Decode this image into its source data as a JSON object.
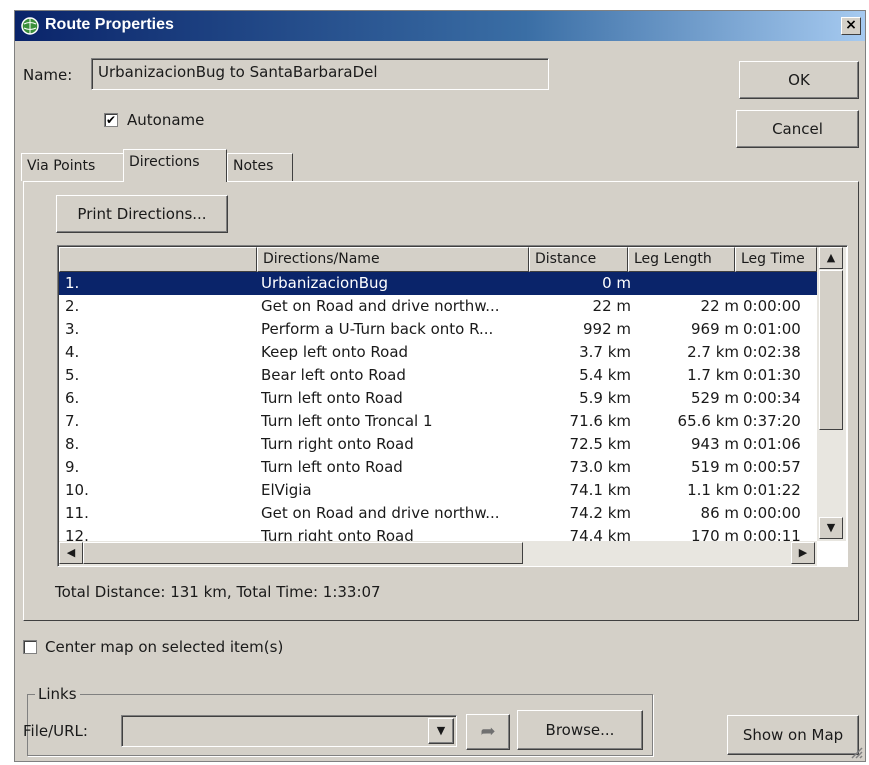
{
  "window": {
    "title": "Route Properties",
    "close_glyph": "×",
    "icon": "globe-icon"
  },
  "name_field": {
    "label": "Name:",
    "value": "UrbanizacionBug to SantaBarbaraDel"
  },
  "autoname": {
    "label": "Autoname",
    "checked": true
  },
  "buttons": {
    "ok": "OK",
    "cancel": "Cancel",
    "print": "Print Directions...",
    "browse": "Browse...",
    "show_on_map": "Show on Map"
  },
  "tabs": [
    {
      "label": "Via Points",
      "active": false
    },
    {
      "label": "Directions",
      "active": true
    },
    {
      "label": "Notes",
      "active": false
    }
  ],
  "table": {
    "columns": [
      "",
      "Directions/Name",
      "Distance",
      "Leg Length",
      "Leg Time"
    ],
    "rows": [
      {
        "num": "1.",
        "name": "UrbanizacionBug",
        "distance": "0 m",
        "leg_length": "",
        "leg_time": "",
        "selected": true
      },
      {
        "num": "2.",
        "name": "Get on Road and drive northw...",
        "distance": "22 m",
        "leg_length": "22 m",
        "leg_time": "0:00:00"
      },
      {
        "num": "3.",
        "name": "Perform a U-Turn back onto R...",
        "distance": "992 m",
        "leg_length": "969 m",
        "leg_time": "0:01:00"
      },
      {
        "num": "4.",
        "name": "Keep left onto Road",
        "distance": "3.7 km",
        "leg_length": "2.7 km",
        "leg_time": "0:02:38"
      },
      {
        "num": "5.",
        "name": "Bear left onto Road",
        "distance": "5.4 km",
        "leg_length": "1.7 km",
        "leg_time": "0:01:30"
      },
      {
        "num": "6.",
        "name": "Turn left onto Road",
        "distance": "5.9 km",
        "leg_length": "529 m",
        "leg_time": "0:00:34"
      },
      {
        "num": "7.",
        "name": "Turn left onto Troncal 1",
        "distance": "71.6 km",
        "leg_length": "65.6 km",
        "leg_time": "0:37:20"
      },
      {
        "num": "8.",
        "name": "Turn right onto Road",
        "distance": "72.5 km",
        "leg_length": "943 m",
        "leg_time": "0:01:06"
      },
      {
        "num": "9.",
        "name": "Turn left onto Road",
        "distance": "73.0 km",
        "leg_length": "519 m",
        "leg_time": "0:00:57"
      },
      {
        "num": "10.",
        "name": "ElVigia",
        "distance": "74.1 km",
        "leg_length": "1.1 km",
        "leg_time": "0:01:22"
      },
      {
        "num": "11.",
        "name": "Get on Road and drive northw...",
        "distance": "74.2 km",
        "leg_length": "86 m",
        "leg_time": "0:00:00"
      },
      {
        "num": "12.",
        "name": "Turn right onto Road",
        "distance": "74.4 km",
        "leg_length": "170 m",
        "leg_time": "0:00:11"
      }
    ]
  },
  "total": "Total Distance: 131 km, Total Time: 1:33:07",
  "center_map": {
    "label": "Center map on selected item(s)",
    "checked": false
  },
  "links": {
    "legend": "Links",
    "file_label": "File/URL:",
    "value": ""
  },
  "colors": {
    "selection": "#0a246a",
    "title_start": "#0a246a",
    "title_end": "#a6caf0",
    "face": "#d4d0c8"
  }
}
